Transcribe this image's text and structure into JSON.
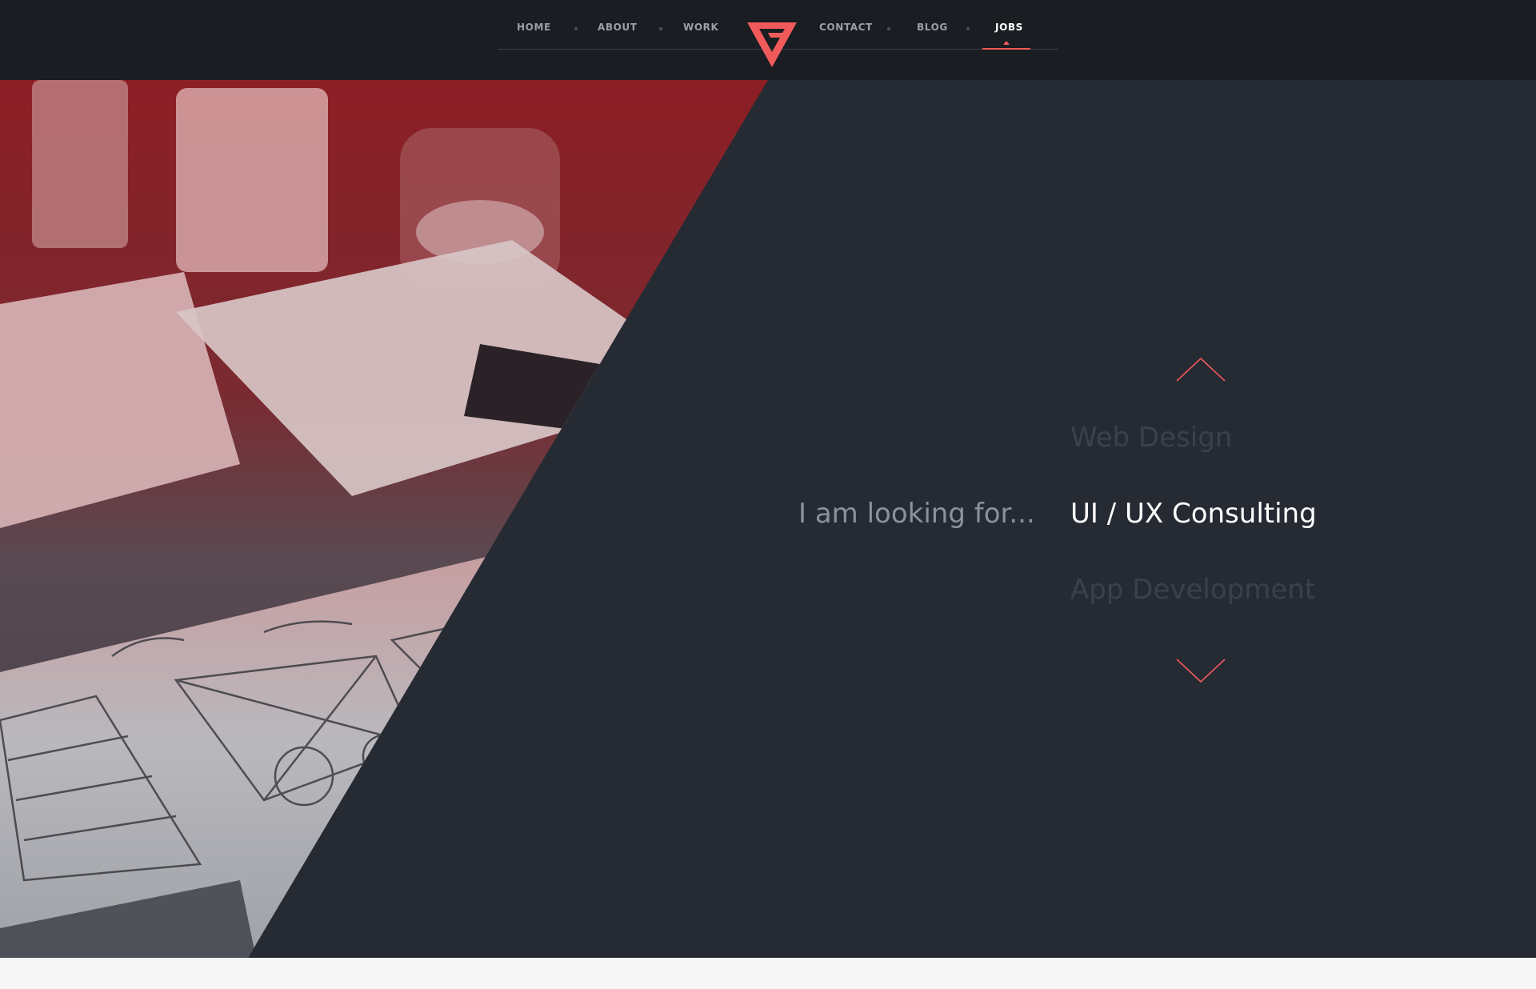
{
  "nav": {
    "items": [
      {
        "label": "HOME"
      },
      {
        "label": "ABOUT"
      },
      {
        "label": "WORK"
      },
      {
        "label": "CONTACT"
      },
      {
        "label": "BLOG"
      },
      {
        "label": "JOBS",
        "active": true
      }
    ],
    "logo_icon": "triangle-v-logo-icon"
  },
  "hero": {
    "prompt": "I am looking for...",
    "options": [
      "Web Design",
      "UI / UX Consulting",
      "App Development"
    ],
    "selected": "UI / UX Consulting",
    "up_icon": "chevron-up-icon",
    "down_icon": "chevron-down-icon"
  },
  "colors": {
    "accent": "#f05a5a",
    "nav_background": "#1a1d22",
    "hero_background": "#252a33",
    "photo_tint": "#8c1e25",
    "text_muted": "#8b929c",
    "text_dim": "#3b414b",
    "text_active": "#ffffff"
  }
}
